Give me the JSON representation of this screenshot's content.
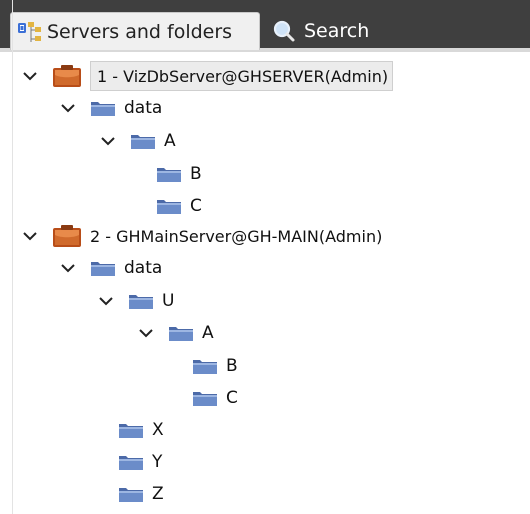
{
  "tabs": [
    {
      "label": "Servers and folders",
      "icon": "tree-icon",
      "active": true
    },
    {
      "label": "Search",
      "icon": "search-icon",
      "active": false
    }
  ],
  "tree": [
    {
      "label": "1 - VizDbServer@GHSERVER(Admin)",
      "type": "server",
      "expanded": true,
      "selected": true
    },
    {
      "label": "data",
      "type": "folder",
      "expanded": true
    },
    {
      "label": "A",
      "type": "folder",
      "expanded": true
    },
    {
      "label": "B",
      "type": "folder"
    },
    {
      "label": "C",
      "type": "folder"
    },
    {
      "label": "2 - GHMainServer@GH-MAIN(Admin)",
      "type": "server",
      "expanded": true
    },
    {
      "label": "data",
      "type": "folder",
      "expanded": true
    },
    {
      "label": "U",
      "type": "folder",
      "expanded": true
    },
    {
      "label": "A",
      "type": "folder",
      "expanded": true
    },
    {
      "label": "B",
      "type": "folder"
    },
    {
      "label": "C",
      "type": "folder"
    },
    {
      "label": "X",
      "type": "folder"
    },
    {
      "label": "Y",
      "type": "folder"
    },
    {
      "label": "Z",
      "type": "folder"
    }
  ],
  "colors": {
    "tabbar": "#3f3f3f",
    "folder": "#5b7bb4",
    "server": "#c0521c"
  }
}
